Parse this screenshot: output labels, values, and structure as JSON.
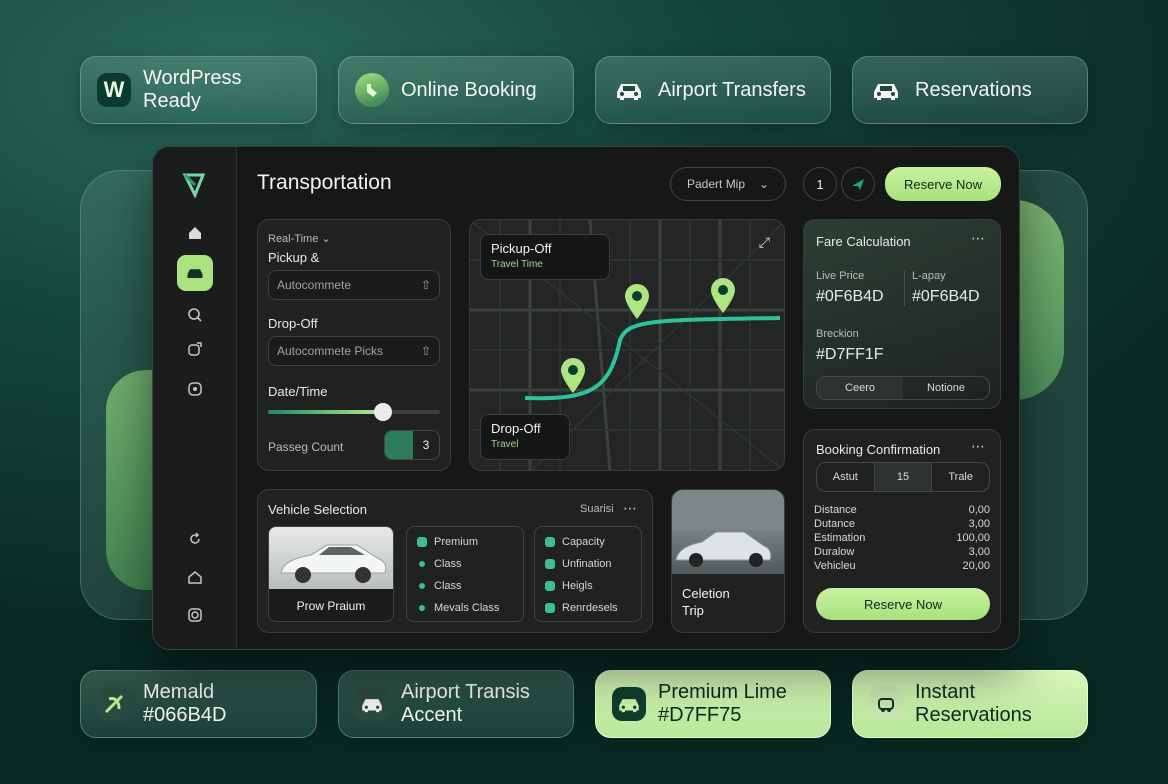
{
  "pills_top": [
    {
      "icon": "wordpress-icon",
      "label": "WordPress Ready"
    },
    {
      "icon": "booking-icon",
      "label": "Online Booking"
    },
    {
      "icon": "car-icon",
      "label": "Airport Transfers"
    },
    {
      "icon": "car-icon",
      "label": "Reservations"
    }
  ],
  "pills_bottom": [
    {
      "icon": "leaf-icon",
      "label1": "Memald",
      "label2": "#066B4D"
    },
    {
      "icon": "car-icon",
      "label1": "Airport Transis",
      "label2": "Accent"
    },
    {
      "icon": "car-icon",
      "label1": "Premium Lime",
      "label2": "#D7FF75"
    },
    {
      "icon": "reservation-icon",
      "label1": "Instant",
      "label2": "Reservations"
    }
  ],
  "header": {
    "title": "Transportation",
    "select": "Padert Mip",
    "count": "1",
    "reserve": "Reserve Now"
  },
  "booking": {
    "realtime": "Real-Time",
    "pickup_label": "Pickup &",
    "pickup_value": "Autocommete",
    "dropoff_label": "Drop-Off",
    "dropoff_value": "Autocommete Picks",
    "datetime_label": "Date/Time",
    "slider_value": 0.68,
    "passenger_label": "Passeg Count",
    "passenger_value": "3"
  },
  "map": {
    "pickup_title": "Pickup-Off",
    "pickup_sub": "Travel Time",
    "dropoff_title": "Drop-Off",
    "dropoff_sub": "Travel"
  },
  "fare": {
    "title": "Fare Calculation",
    "live_label": "Live Price",
    "live_value": "#0F6B4D",
    "cap_label": "L-apay",
    "cap_value": "#0F6B4D",
    "brk_label": "Breckion",
    "brk_value": "#D7FF1F",
    "tab1": "Ceero",
    "tab2": "Notione"
  },
  "vehicle": {
    "title": "Vehicle Selection",
    "search": "Suarisi",
    "car_label": "Prow Praium",
    "list1": [
      "Premium",
      "Class",
      "Class",
      "Mevals Class"
    ],
    "list2": [
      "Capacity",
      "Unfination",
      "Heigls",
      "Renrdesels"
    ],
    "photo_line1": "Celetion",
    "photo_line2": "Trip"
  },
  "confirm": {
    "title": "Booking Confirmation",
    "seg1": "Astut",
    "seg2": "15",
    "seg3": "Trale",
    "rows": [
      {
        "k": "Distance",
        "v": "0,00"
      },
      {
        "k": "Dutance",
        "v": "3,00"
      },
      {
        "k": "Estimation",
        "v": "100,00"
      },
      {
        "k": "Duralow",
        "v": "3,00"
      },
      {
        "k": "Vehicleu",
        "v": "20,00"
      }
    ],
    "reserve": "Reserve Now"
  },
  "colors": {
    "emerald": "#066B4D",
    "lime": "#D7FF75",
    "panel": "#161817"
  }
}
